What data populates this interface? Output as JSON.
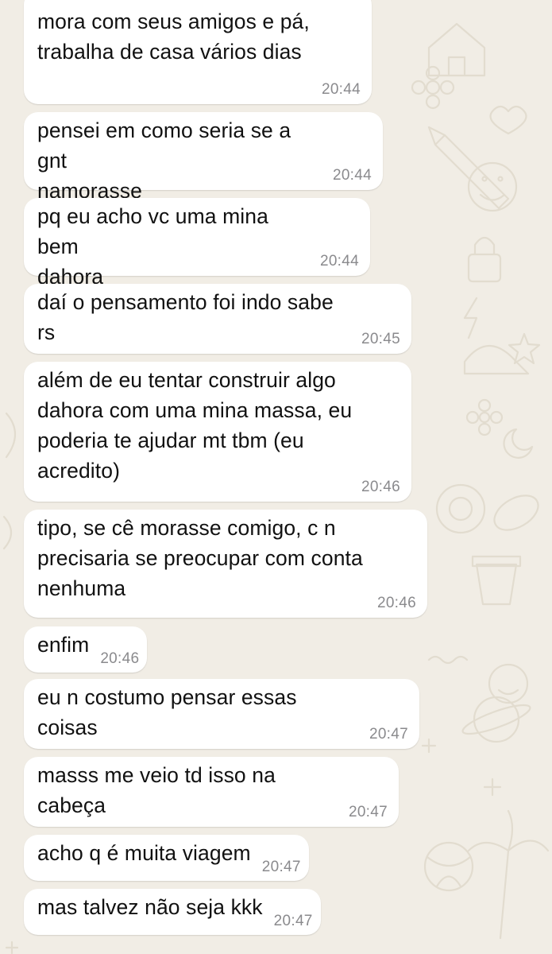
{
  "chat": {
    "messages": [
      {
        "text": "mora com seus amigos e pá,\ntrabalha de casa vários dias",
        "time": "20:44"
      },
      {
        "text": "pensei em como seria se a gnt\nnamorasse",
        "time": "20:44"
      },
      {
        "text": "pq eu acho vc uma mina bem\ndahora",
        "time": "20:44"
      },
      {
        "text": "daí o pensamento foi indo sabe rs",
        "time": "20:45"
      },
      {
        "text": "além de eu tentar construir algo\ndahora com uma mina massa, eu\npoderia te ajudar mt tbm (eu\nacredito)",
        "time": "20:46"
      },
      {
        "text": "tipo, se cê morasse comigo, c n\nprecisaria se preocupar com conta\nnenhuma",
        "time": "20:46"
      },
      {
        "text": "enfim",
        "time": "20:46"
      },
      {
        "text": "eu n costumo pensar essas coisas",
        "time": "20:47"
      },
      {
        "text": "masss me veio td isso na cabeça",
        "time": "20:47"
      },
      {
        "text": "acho q é muita viagem",
        "time": "20:47"
      },
      {
        "text": "mas talvez não seja kkk",
        "time": "20:47"
      }
    ]
  },
  "colors": {
    "wallpaper": "#f1ede5",
    "doodle": "#e2dccf",
    "bubble": "#ffffff",
    "message_text": "#111111",
    "timestamp": "#8a8a8d"
  }
}
